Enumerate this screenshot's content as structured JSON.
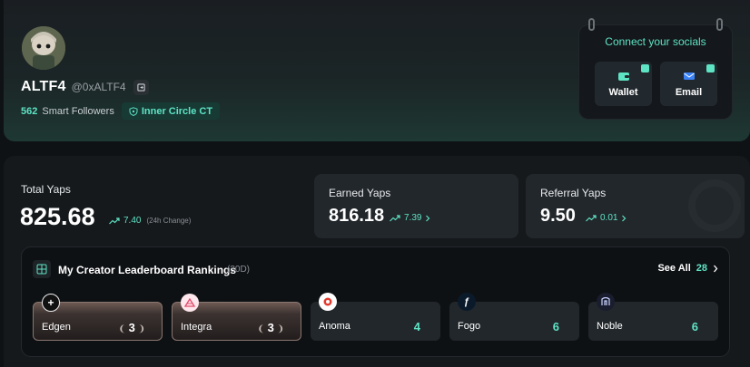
{
  "profile": {
    "display_name": "ALTF4",
    "username": "@0xALTF4",
    "followers_count": "562",
    "followers_label": "Smart Followers",
    "badge": "Inner Circle CT"
  },
  "socials": {
    "title": "Connect your socials",
    "buttons": [
      {
        "label": "Wallet",
        "icon": "wallet-icon"
      },
      {
        "label": "Email",
        "icon": "mail-icon"
      }
    ]
  },
  "yaps": {
    "total": {
      "label": "Total Yaps",
      "value": "825.68",
      "change": "7.40",
      "note": "(24h Change)"
    },
    "earned": {
      "label": "Earned Yaps",
      "value": "816.18",
      "change": "7.39"
    },
    "referral": {
      "label": "Referral Yaps",
      "value": "9.50",
      "change": "0.01"
    }
  },
  "leaderboard": {
    "title": "My Creator Leaderboard Rankings",
    "period": "(30D)",
    "see_all_label": "See All",
    "see_all_count": "28",
    "items": [
      {
        "name": "Edgen",
        "rank": "3",
        "logo": "plus-icon"
      },
      {
        "name": "Integra",
        "rank": "3",
        "logo": "integra-logo-icon"
      },
      {
        "name": "Anoma",
        "rank": "4",
        "logo": "anoma-logo-icon"
      },
      {
        "name": "Fogo",
        "rank": "6",
        "logo": "fogo-logo-icon"
      },
      {
        "name": "Noble",
        "rank": "6",
        "logo": "noble-logo-icon"
      }
    ]
  },
  "colors": {
    "accent": "#5ee3c4",
    "background": "#0f1215",
    "card": "#22272b"
  }
}
